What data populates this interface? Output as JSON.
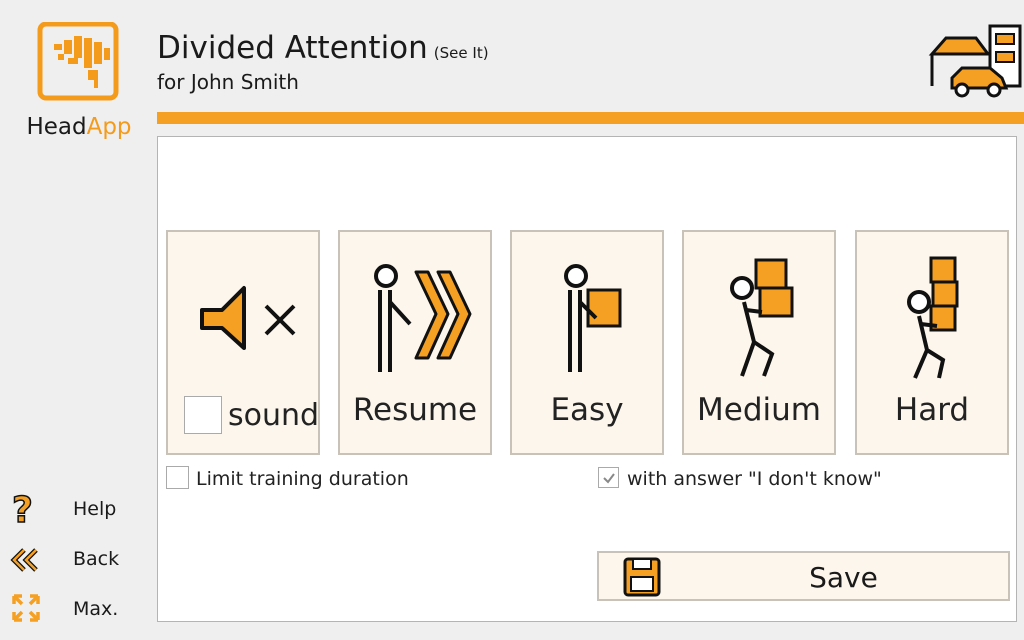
{
  "app": {
    "logo_word_head": "Head",
    "logo_word_app": "App"
  },
  "header": {
    "title": "Divided Attention",
    "subtitle": "(See It)",
    "user": "for John Smith"
  },
  "modes": {
    "sound": {
      "label": "sound",
      "checked": false
    },
    "resume": {
      "label": "Resume"
    },
    "easy": {
      "label": "Easy"
    },
    "medium": {
      "label": "Medium"
    },
    "hard": {
      "label": "Hard"
    }
  },
  "options": {
    "limit_duration": {
      "label": "Limit training duration",
      "checked": false
    },
    "dont_know": {
      "label": "with answer \"I don't know\"",
      "checked": true
    }
  },
  "save": {
    "label": "Save"
  },
  "nav": {
    "help": "Help",
    "back": "Back",
    "max": "Max."
  },
  "colors": {
    "accent": "#f5a023",
    "card_bg": "#fdf6ec",
    "panel_bg": "#ffffff",
    "page_bg": "#efefef"
  }
}
